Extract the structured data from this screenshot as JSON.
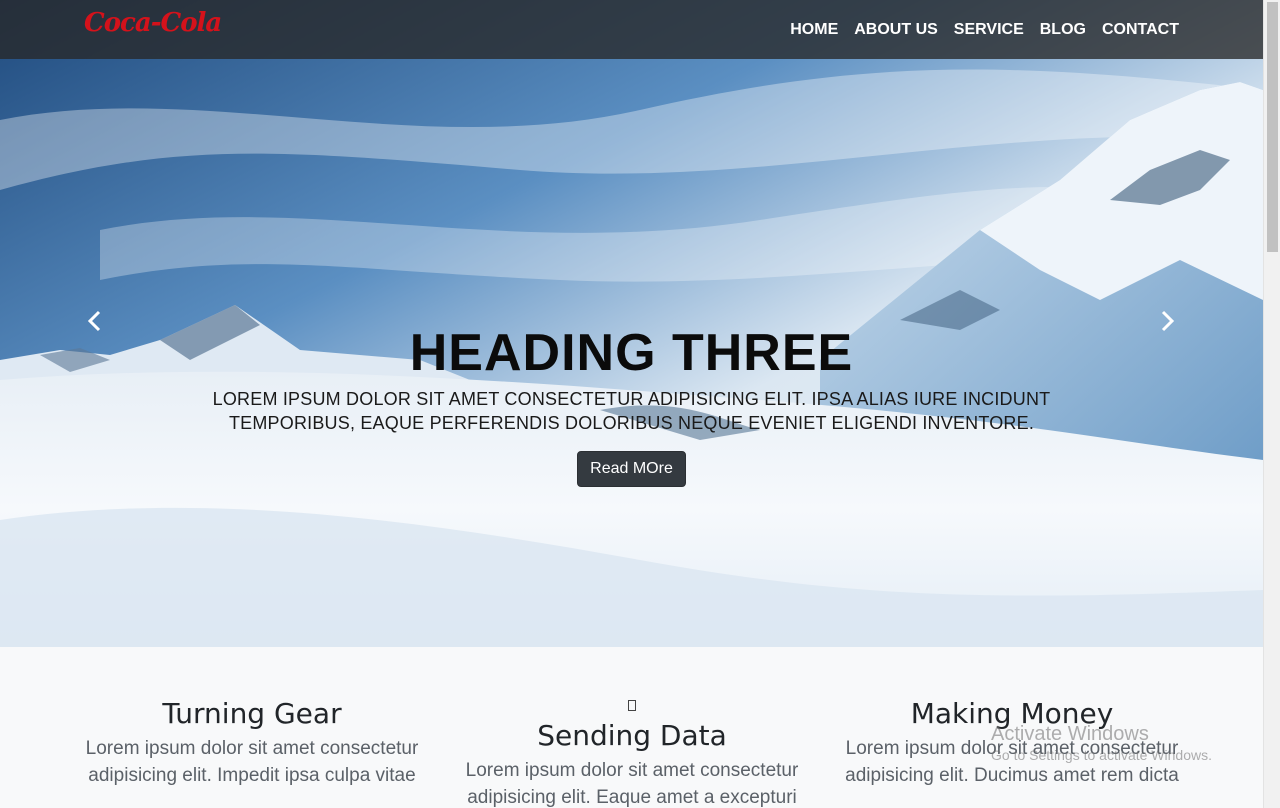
{
  "navbar": {
    "brand": "Coca-Cola",
    "items": [
      {
        "label": "HOME"
      },
      {
        "label": "ABOUT US"
      },
      {
        "label": "SERVICE"
      },
      {
        "label": "BLOG"
      },
      {
        "label": "CONTACT"
      }
    ]
  },
  "hero": {
    "heading": "HEADING THREE",
    "text": "Lorem ipsum dolor sit amet consectetur adipisicing elit. Ipsa alias iure incidunt temporibus, eaque perferendis doloribus neque eveniet eligendi inventore.",
    "button": "Read MOre",
    "prev_icon": "chevron-left-icon",
    "next_icon": "chevron-right-icon"
  },
  "features": [
    {
      "title": "Turning Gear",
      "text": "Lorem ipsum dolor sit amet consectetur adipisicing elit. Impedit ipsa culpa vitae"
    },
    {
      "icon": "data-icon",
      "title": "Sending Data",
      "text": "Lorem ipsum dolor sit amet consectetur adipisicing elit. Eaque amet a excepturi"
    },
    {
      "title": "Making Money",
      "text": "Lorem ipsum dolor sit amet consectetur adipisicing elit. Ducimus amet rem dicta"
    }
  ],
  "watermark": {
    "line1": "Activate Windows",
    "line2": "Go to Settings to activate Windows."
  },
  "colors": {
    "brand": "#d4121b",
    "navbar": "#282828",
    "button": "#343a40",
    "features_bg": "#f8f9fa"
  }
}
